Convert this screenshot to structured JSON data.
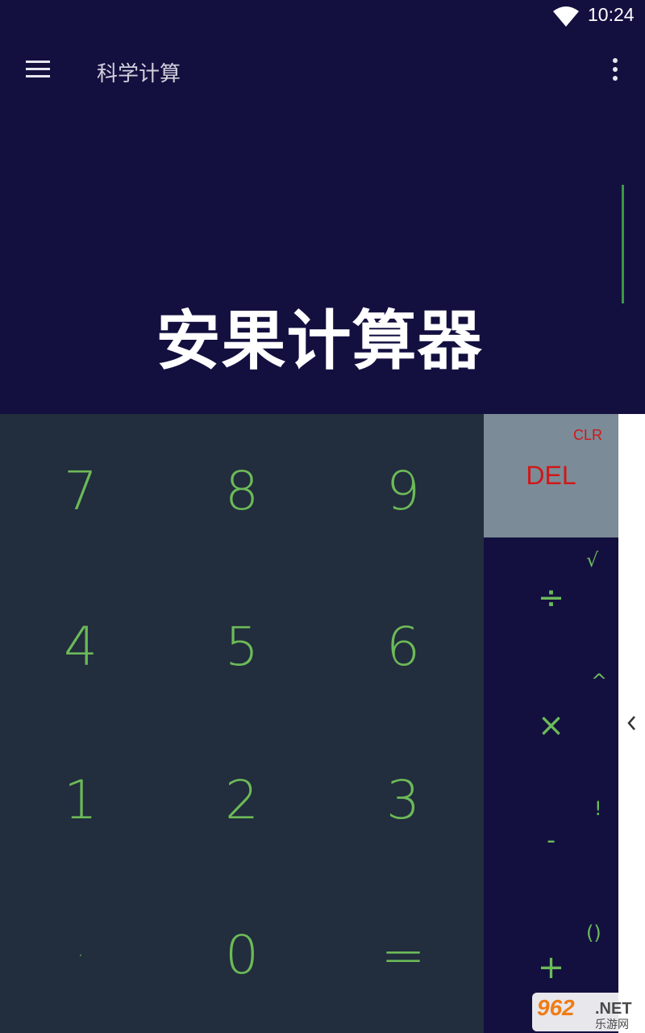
{
  "status_bar": {
    "time": "10:24",
    "wifi_icon": "wifi-icon"
  },
  "toolbar": {
    "title": "科学计算",
    "menu_icon": "hamburger-menu-icon",
    "overflow_icon": "more-vert-icon"
  },
  "display": {
    "overlay_text": "安果计算器"
  },
  "numpad": {
    "keys": [
      "7",
      "8",
      "9",
      "4",
      "5",
      "6",
      "1",
      "2",
      "3",
      "·",
      "0",
      "="
    ]
  },
  "side_panel": {
    "clr": "CLR",
    "del": "DEL",
    "ops": {
      "divide": "÷",
      "sqrt": "√",
      "multiply": "×",
      "power": "^",
      "minus": "-",
      "factorial": "!",
      "plus": "+",
      "parens": "()"
    }
  },
  "drawer": {
    "chevron_icon": "chevron-left-icon"
  },
  "logo": {
    "text": "962",
    "suffix": ".NET",
    "subtitle": "乐游网"
  },
  "colors": {
    "background": "#131040",
    "numpad": "#222d3d",
    "accent_green": "#6cba58",
    "del_panel": "#7b8b98",
    "danger_red": "#d01818"
  }
}
